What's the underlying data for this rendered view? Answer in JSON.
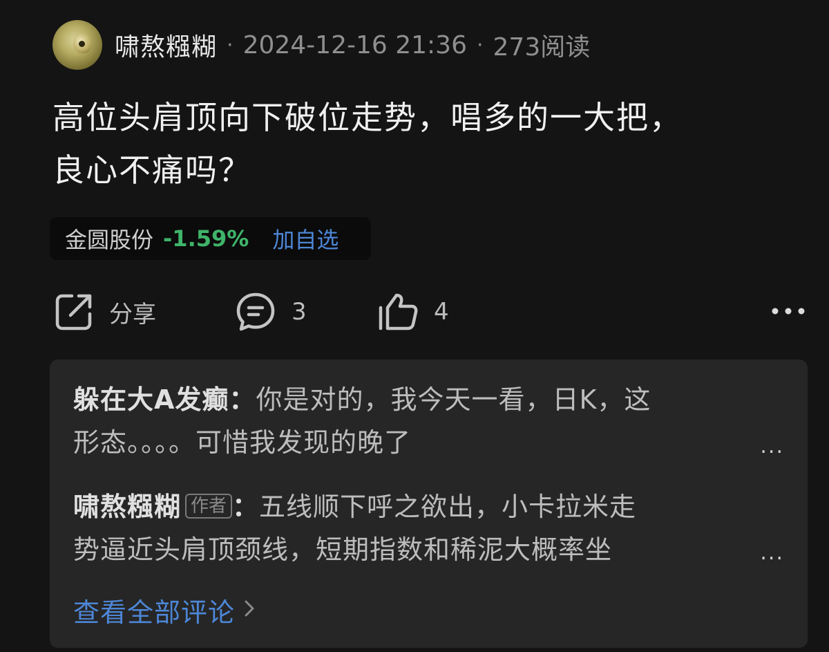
{
  "post": {
    "author": "啸熬糨糊",
    "separator": "·",
    "datetime": "2024-12-16 21:36",
    "reads": "273阅读",
    "title_line1": "高位头肩顶向下破位走势，唱多的一大把，",
    "title_line2": "良心不痛吗？"
  },
  "stock": {
    "name": "金圆股份",
    "change": "-1.59%",
    "add_label": "加自选",
    "change_color": "#3fb46a"
  },
  "actions": {
    "share_label": "分享",
    "comment_count": "3",
    "like_count": "4",
    "share_icon": "share-icon",
    "comment_icon": "comment-bubble-icon",
    "like_icon": "thumbs-up-icon",
    "more_icon": "more-dots-icon"
  },
  "comments": [
    {
      "author": "躲在大A发癫",
      "colon": "：",
      "text_line1": "你是对的，我今天一看，日K，这",
      "text_line2": "形态。。。。可惜我发现的晚了",
      "ellipsis": "..."
    },
    {
      "author": "啸熬糨糊",
      "tag": "作者",
      "colon": "：",
      "text_line1": "五线顺下呼之欲出，小卡拉米走",
      "text_line2": "势逼近头肩顶颈线，短期指数和稀泥大概率坐",
      "ellipsis": "..."
    }
  ],
  "view_all": {
    "label": "查看全部评论",
    "icon": "chevron-right-icon",
    "color": "#4d86d6"
  }
}
